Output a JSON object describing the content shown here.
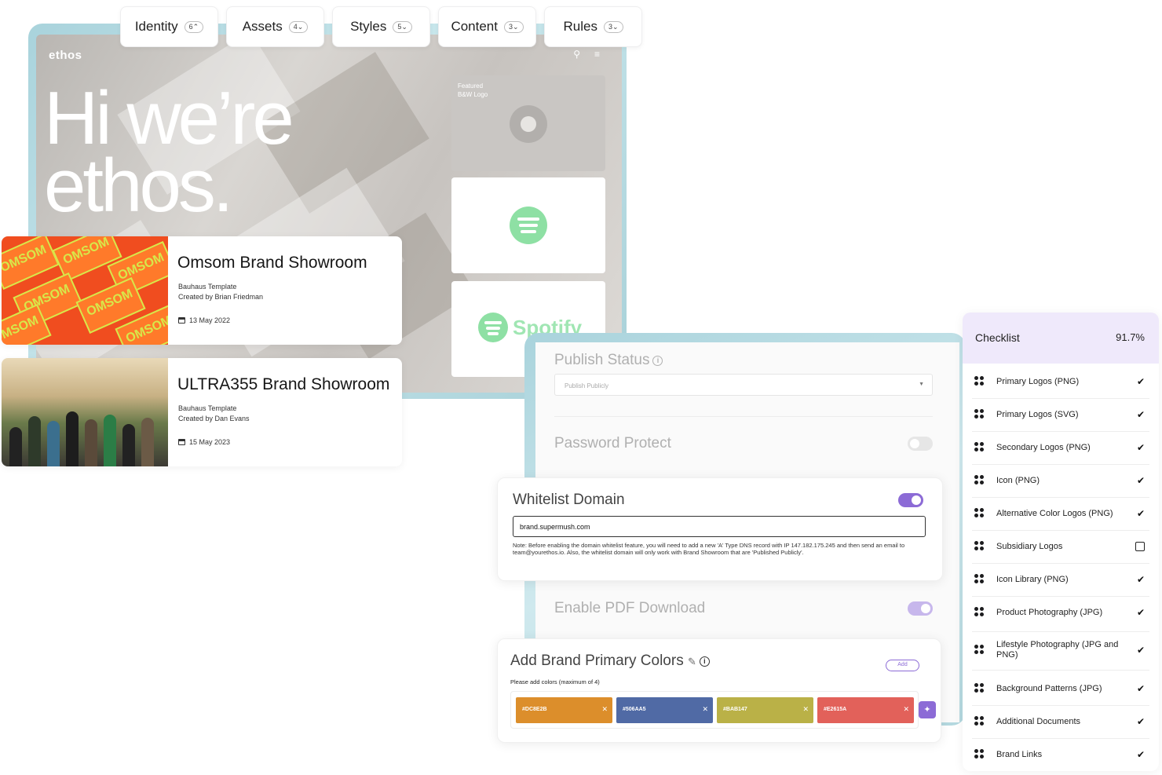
{
  "tabs": [
    {
      "label": "Identity",
      "count": "6"
    },
    {
      "label": "Assets",
      "count": "4"
    },
    {
      "label": "Styles",
      "count": "5"
    },
    {
      "label": "Content",
      "count": "3"
    },
    {
      "label": "Rules",
      "count": "3"
    }
  ],
  "hero": {
    "logo": "ethos",
    "title_line1": "Hi we’re",
    "title_line2": "ethos.",
    "featured_caption_1": "Featured",
    "featured_caption_2": "B&W Logo",
    "spotify_word": "Spotify"
  },
  "showrooms": [
    {
      "title": "Omsom Brand Showroom",
      "template": "Bauhaus Template",
      "creator": "Created by Brian Friedman",
      "date": "13 May 2022"
    },
    {
      "title": "ULTRA355 Brand Showroom",
      "template": "Bauhaus Template",
      "creator": "Created by Dan Evans",
      "date": "15 May 2023"
    }
  ],
  "settings": {
    "publish_status_label": "Publish Status",
    "publish_status_value": "Publish Publicly",
    "password_label": "Password Protect",
    "password_enabled": false,
    "whitelist_label": "Whitelist Domain",
    "whitelist_enabled": true,
    "whitelist_value": "brand.supermush.com",
    "whitelist_note": "Note: Before enabling the domain whitelist feature, you will need to add a new 'A' Type DNS record with IP 147.182.175.245 and then send an email to team@yourethos.io. Also, the whitelist domain will only work with Brand Showroom that are 'Published Publicly'.",
    "pdf_label": "Enable PDF Download",
    "pdf_enabled": true,
    "colors_label": "Add Brand Primary Colors",
    "colors_hint": "Please add colors (maximum of 4)",
    "add_label": "Add",
    "colors": [
      {
        "hex": "#DC8E2B",
        "label": "#DC8E2B"
      },
      {
        "hex": "#506AA5",
        "label": "#506AA5"
      },
      {
        "hex": "#BAB147",
        "label": "#BAB147"
      },
      {
        "hex": "#E2615A",
        "label": "#E2615A"
      }
    ]
  },
  "checklist": {
    "title": "Checklist",
    "percent": "91.7%",
    "items": [
      {
        "label": "Primary Logos (PNG)",
        "checked": true
      },
      {
        "label": "Primary Logos (SVG)",
        "checked": true
      },
      {
        "label": "Secondary Logos (PNG)",
        "checked": true
      },
      {
        "label": "Icon (PNG)",
        "checked": true
      },
      {
        "label": "Alternative Color Logos (PNG)",
        "checked": true
      },
      {
        "label": "Subsidiary Logos",
        "checked": false
      },
      {
        "label": "Icon Library (PNG)",
        "checked": true
      },
      {
        "label": "Product Photography (JPG)",
        "checked": true
      },
      {
        "label": "Lifestyle Photography (JPG and PNG)",
        "checked": true
      },
      {
        "label": "Background Patterns (JPG)",
        "checked": true
      },
      {
        "label": "Additional Documents",
        "checked": true
      },
      {
        "label": "Brand Links",
        "checked": true
      }
    ]
  },
  "colors": {
    "accent": "#8C6BD6",
    "checklist_header": "#EFE9FB",
    "frame": "#A9D3DC",
    "spotify_green": "#8EE0A4"
  }
}
